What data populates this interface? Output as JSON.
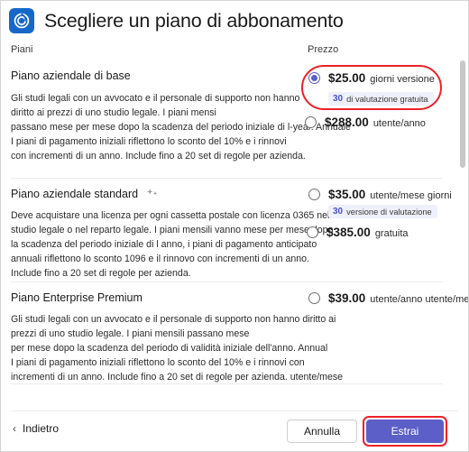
{
  "header": {
    "icon_name": "app-logo-icon",
    "title": "Scegliere un piano di abbonamento",
    "icon_bg": "#1668c8"
  },
  "columns": {
    "plans_label": "Piani",
    "price_label": "Prezzo"
  },
  "plans": [
    {
      "title": "Piano aziendale di base",
      "has_sparkle": false,
      "description_lines": [
        "Gli studi legali con un avvocato e il personale di supporto non hanno",
        "diritto ai prezzi di uno studio legale. I piani mensi",
        "passano mese per mese dopo la scadenza del periodo iniziale di l-year. Annuale",
        "I piani di pagamento iniziali riflettono lo sconto del 10% e i rinnovi",
        "con incrementi di un anno. Include fino a 20 set di regole per azienda."
      ],
      "options": [
        {
          "selected": true,
          "amount": "$25.00",
          "unit": "giorni versione",
          "badge": {
            "number": "30",
            "text": "di valutazione gratuita"
          }
        },
        {
          "selected": false,
          "amount": "$288.00",
          "unit": "utente/anno",
          "badge": null
        }
      ],
      "highlighted": true
    },
    {
      "title": "Piano aziendale standard",
      "has_sparkle": true,
      "sparkle_icon_name": "sparkle-icon",
      "description_lines": [
        "Deve acquistare una licenza per ogni cassetta postale con licenza 0365 nello",
        "studio legale o nel reparto legale. I piani mensili vanno mese per mese dopo",
        "la scadenza del periodo iniziale di l anno, i piani di pagamento anticipato",
        "annuali riflettono lo sconto 1096 e il rinnovo con incrementi di un anno.",
        "Include fino a 20 set di regole per azienda."
      ],
      "options": [
        {
          "selected": false,
          "amount": "$35.00",
          "unit": "utente/mese giorni",
          "badge": {
            "number": "30",
            "text": "versione di valutazione"
          }
        },
        {
          "selected": false,
          "amount": "$385.00",
          "unit": "gratuita",
          "badge": null
        }
      ],
      "highlighted": false
    },
    {
      "title": "Piano Enterprise Premium",
      "has_sparkle": false,
      "description_lines": [
        "Gli studi legali con un avvocato e il personale di supporto non hanno diritto ai",
        "prezzi di uno studio legale. I piani mensili passano mese",
        "per mese dopo la scadenza del periodo di validità iniziale dell'anno. Annual",
        "I piani di pagamento iniziali riflettono lo sconto del 10% e i rinnovi con",
        "incrementi di un anno. Include fino a 20 set di regole per azienda. utente/mese"
      ],
      "options": [
        {
          "selected": false,
          "amount": "$39.00",
          "unit": "utente/anno utente/mese",
          "badge": null
        }
      ],
      "highlighted": false
    }
  ],
  "scrollbar": {
    "name": "vertical-scrollbar"
  },
  "footer": {
    "back_chevron": "‹",
    "back_label": "Indietro",
    "cancel_label": "Annulla",
    "submit_label": "Estrai",
    "submit_color": "#5b5fc7"
  },
  "highlight": {
    "color": "#ec2227"
  }
}
